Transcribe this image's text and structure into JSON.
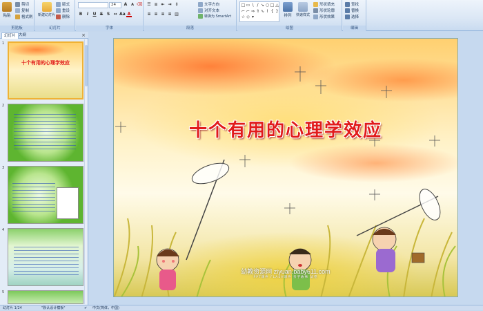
{
  "ribbon": {
    "clipboard": {
      "label": "剪贴板",
      "paste": "粘贴",
      "cut": "剪切",
      "copy": "复制",
      "format_painter": "格式刷"
    },
    "slides": {
      "label": "幻灯片",
      "new_slide": "新建幻灯片",
      "layout": "版式",
      "reset": "重设",
      "delete": "删除"
    },
    "font": {
      "label": "字体",
      "font_size": "24"
    },
    "paragraph": {
      "label": "段落",
      "text_direction": "文字方向",
      "align_text": "对齐文本",
      "smartart": "转换为 SmartArt"
    },
    "drawing": {
      "label": "绘图",
      "arrange": "排列",
      "quick_styles": "快速样式",
      "shape_fill": "形状填充",
      "shape_outline": "形状轮廓",
      "shape_effects": "形状效果"
    },
    "editing": {
      "label": "编辑",
      "find": "查找",
      "replace": "替换",
      "select": "选择"
    }
  },
  "left_panel": {
    "tab_slides": "幻灯片",
    "tab_outline": "大纲",
    "close": "×",
    "slide_numbers": [
      "1",
      "2",
      "3",
      "4",
      "5"
    ]
  },
  "slide": {
    "title": "十个有用的心理学效应",
    "watermark": "幼教资源网 ziyuan.baby611.com",
    "watermark_sub": "PPT课件  FLASH课件  亲子故事  试卷"
  },
  "statusbar": {
    "slide_count": "幻灯片 1/24",
    "theme": "\"默认设计模板\"",
    "language": "中文(简体，中国)"
  },
  "colors": {
    "title_red": "#e11b1b",
    "selected_thumb_border": "#f0b234",
    "ribbon_bg": "#dbe7f5"
  }
}
